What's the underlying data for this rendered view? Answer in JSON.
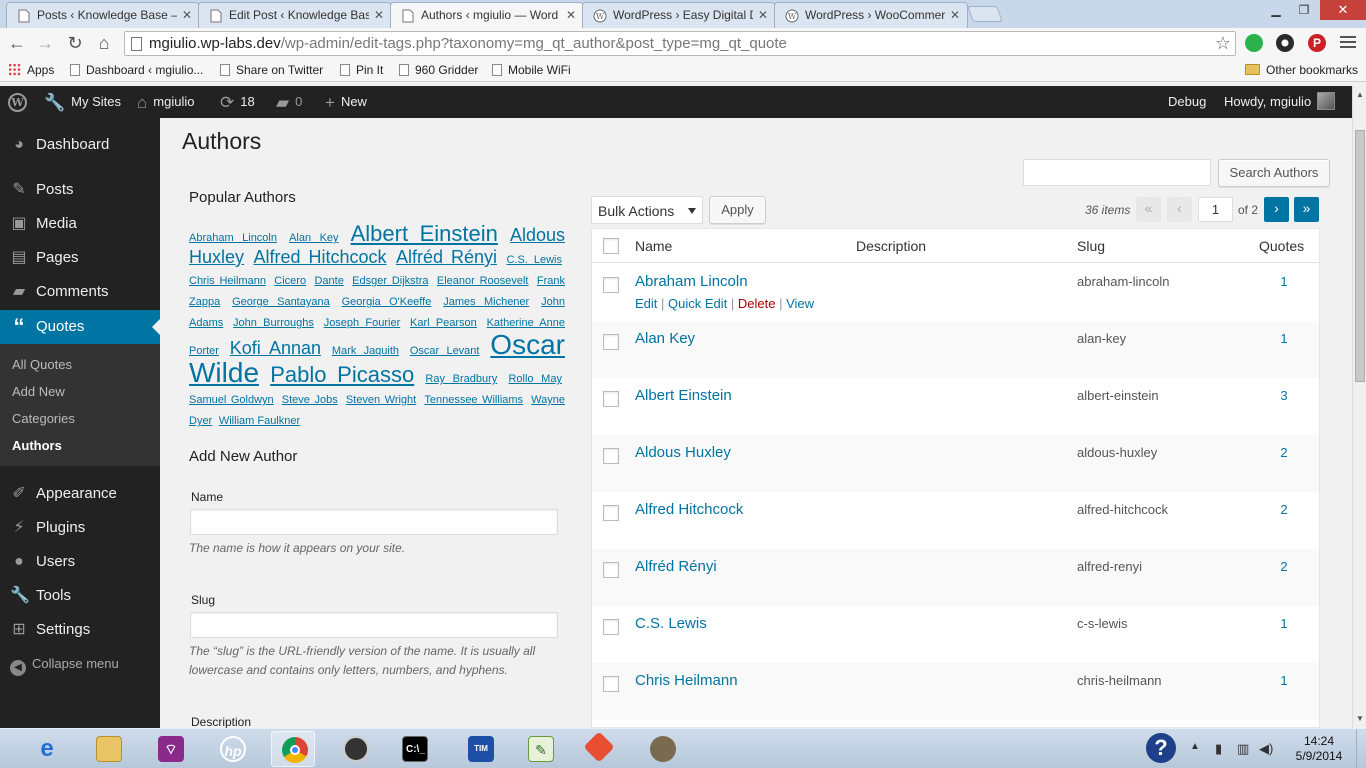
{
  "browser": {
    "tabs": [
      {
        "label": "Posts ‹ Knowledge Base —",
        "active": false
      },
      {
        "label": "Edit Post ‹ Knowledge Bas",
        "active": false
      },
      {
        "label": "Authors ‹ mgiulio — Word",
        "active": true
      },
      {
        "label": "WordPress › Easy Digital D",
        "active": false
      },
      {
        "label": "WordPress › WooCommer",
        "active": false
      }
    ],
    "url_host": "mgiulio.wp-labs.dev",
    "url_path": "/wp-admin/edit-tags.php?taxonomy=mg_qt_author&post_type=mg_qt_quote",
    "bookmarks": [
      "Apps",
      "Dashboard ‹ mgiulio...",
      "Share on Twitter",
      "Pin It",
      "960 Gridder",
      "Mobile WiFi"
    ],
    "other_bookmarks": "Other bookmarks"
  },
  "adminbar": {
    "my_sites": "My Sites",
    "site": "mgiulio",
    "updates": "18",
    "comments": "0",
    "new": "New",
    "debug": "Debug",
    "howdy": "Howdy, mgiulio"
  },
  "menu": {
    "items": [
      "Dashboard",
      "Posts",
      "Media",
      "Pages",
      "Comments",
      "Quotes",
      "Appearance",
      "Plugins",
      "Users",
      "Tools",
      "Settings"
    ],
    "submenu": [
      "All Quotes",
      "Add New",
      "Categories",
      "Authors"
    ],
    "collapse": "Collapse menu"
  },
  "page": {
    "title": "Authors",
    "search_button": "Search Authors",
    "popular_heading": "Popular Authors",
    "cloud": [
      {
        "name": "Abraham Lincoln",
        "weight": 1
      },
      {
        "name": "Alan Key",
        "weight": 1
      },
      {
        "name": "Albert Einstein",
        "weight": 3
      },
      {
        "name": "Aldous Huxley",
        "weight": 2
      },
      {
        "name": "Alfred Hitchcock",
        "weight": 2
      },
      {
        "name": "Alfréd Rényi",
        "weight": 2
      },
      {
        "name": "C.S. Lewis",
        "weight": 1
      },
      {
        "name": "Chris Heilmann",
        "weight": 1
      },
      {
        "name": "Cicero",
        "weight": 1
      },
      {
        "name": "Dante",
        "weight": 1
      },
      {
        "name": "Edsger Dijkstra",
        "weight": 1
      },
      {
        "name": "Eleanor Roosevelt",
        "weight": 1
      },
      {
        "name": "Frank Zappa",
        "weight": 1
      },
      {
        "name": "George Santayana",
        "weight": 1
      },
      {
        "name": "Georgia O'Keeffe",
        "weight": 1
      },
      {
        "name": "James Michener",
        "weight": 1
      },
      {
        "name": "John Adams",
        "weight": 1
      },
      {
        "name": "John Burroughs",
        "weight": 1
      },
      {
        "name": "Joseph Fourier",
        "weight": 1
      },
      {
        "name": "Karl Pearson",
        "weight": 1
      },
      {
        "name": "Katherine Anne Porter",
        "weight": 1
      },
      {
        "name": "Kofi Annan",
        "weight": 2
      },
      {
        "name": "Mark Jaquith",
        "weight": 1
      },
      {
        "name": "Oscar Levant",
        "weight": 1
      },
      {
        "name": "Oscar Wilde",
        "weight": 4
      },
      {
        "name": "Pablo Picasso",
        "weight": 3
      },
      {
        "name": "Ray Bradbury",
        "weight": 1
      },
      {
        "name": "Rollo May",
        "weight": 1
      },
      {
        "name": "Samuel Goldwyn",
        "weight": 1
      },
      {
        "name": "Steve Jobs",
        "weight": 1
      },
      {
        "name": "Steven Wright",
        "weight": 1
      },
      {
        "name": "Tennessee Williams",
        "weight": 1
      },
      {
        "name": "Wayne Dyer",
        "weight": 1
      },
      {
        "name": "William Faulkner",
        "weight": 1
      }
    ],
    "add_heading": "Add New Author",
    "name_label": "Name",
    "name_help": "The name is how it appears on your site.",
    "slug_label": "Slug",
    "slug_help": "The “slug” is the URL-friendly version of the name. It is usually all lowercase and contains only letters, numbers, and hyphens.",
    "description_label": "Description",
    "bulk_actions": "Bulk Actions",
    "apply": "Apply",
    "items_count": "36 items",
    "current_page": "1",
    "of_pages": "of 2",
    "columns": {
      "name": "Name",
      "description": "Description",
      "slug": "Slug",
      "quotes": "Quotes"
    },
    "row_actions": {
      "edit": "Edit",
      "quick_edit": "Quick Edit",
      "delete": "Delete",
      "view": "View"
    },
    "rows": [
      {
        "name": "Abraham Lincoln",
        "slug": "abraham-lincoln",
        "count": "1"
      },
      {
        "name": "Alan Key",
        "slug": "alan-key",
        "count": "1"
      },
      {
        "name": "Albert Einstein",
        "slug": "albert-einstein",
        "count": "3"
      },
      {
        "name": "Aldous Huxley",
        "slug": "aldous-huxley",
        "count": "2"
      },
      {
        "name": "Alfred Hitchcock",
        "slug": "alfred-hitchcock",
        "count": "2"
      },
      {
        "name": "Alfréd Rényi",
        "slug": "alfred-renyi",
        "count": "2"
      },
      {
        "name": "C.S. Lewis",
        "slug": "c-s-lewis",
        "count": "1"
      },
      {
        "name": "Chris Heilmann",
        "slug": "chris-heilmann",
        "count": "1"
      }
    ]
  },
  "taskbar": {
    "time": "14:24",
    "date": "5/9/2014"
  },
  "colors": {
    "wp_blue": "#0074a2",
    "admin_dark": "#222222",
    "delete_red": "#aa0000"
  }
}
